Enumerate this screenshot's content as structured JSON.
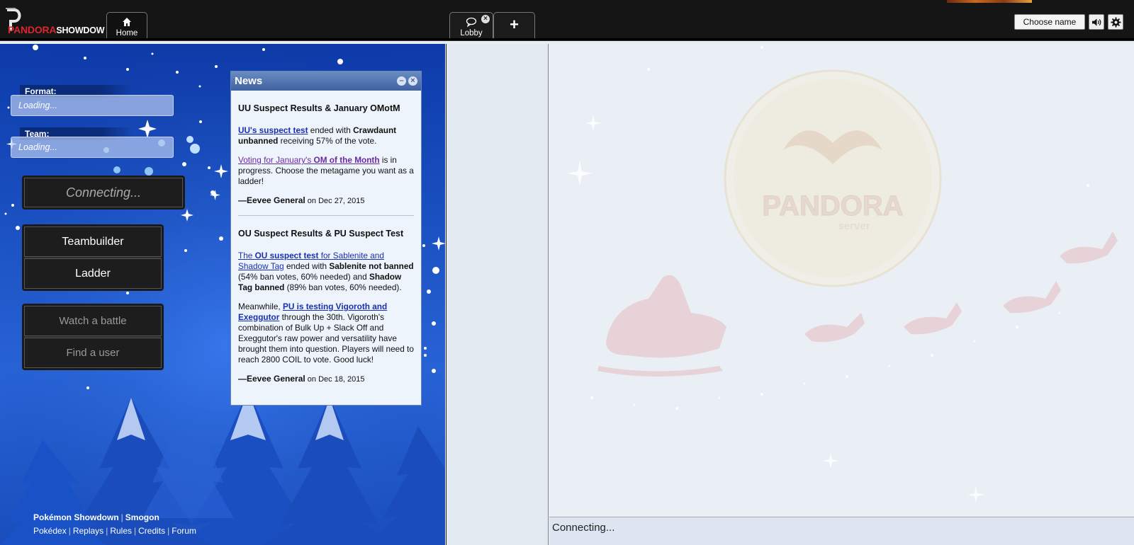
{
  "header": {
    "logo_red": "PANDORA",
    "logo_white": "SHOWDOW",
    "tabs": [
      {
        "label": "Home",
        "icon": "home-icon"
      },
      {
        "label": "Lobby",
        "icon": "chat-bubble-icon"
      },
      {
        "label": "+",
        "icon": "plus-icon"
      }
    ],
    "choose_name": "Choose name",
    "volume_icon": "volume-icon",
    "settings_icon": "gear-icon"
  },
  "home": {
    "format_label": "Format:",
    "format_value": "Loading...",
    "team_label": "Team:",
    "team_value": "Loading...",
    "connect_button": "Connecting...",
    "teambuilder_button": "Teambuilder",
    "ladder_button": "Ladder",
    "watch_button": "Watch a battle",
    "find_user_button": "Find a user",
    "footer": {
      "row1": [
        "Pokémon Showdown",
        "Smogon"
      ],
      "row2": [
        "Pokédex",
        "Replays",
        "Rules",
        "Credits",
        "Forum"
      ]
    }
  },
  "news": {
    "title": "News",
    "items": [
      {
        "title": "UU Suspect Results & January OMotM",
        "p1_link": "UU's suspect test",
        "p1_text1": " ended with ",
        "p1_bold": "Crawdaunt unbanned",
        "p1_text2": " receiving 57% of the vote.",
        "p2_link_a": "Voting for January's ",
        "p2_link_b": "OM of the Month",
        "p2_text": " is in progress. Choose the metagame you want as a ladder!",
        "author": "—Eevee General",
        "date": " on Dec 27, 2015"
      },
      {
        "title": "OU Suspect Results & PU Suspect Test",
        "p1_link_a": "The ",
        "p1_link_b": "OU suspect test",
        "p1_link_c": " for Sablenite and Shadow Tag",
        "p1_text1": " ended with ",
        "p1_bold1": "Sablenite not banned",
        "p1_text2": " (54% ban votes, 60% needed) and ",
        "p1_bold2": "Shadow Tag banned",
        "p1_text3": " (89% ban votes, 60% needed).",
        "p2_text1": "Meanwhile, ",
        "p2_link": "PU is testing Vigoroth and Exeggutor",
        "p2_text2": " through the 30th. Vigoroth's combination of Bulk Up + Slack Off and Exeggutor's raw power and versatility have brought them into question. Players will need to reach 2800 COIL to vote. Good luck!",
        "author": "—Eevee General",
        "date": " on Dec 18, 2015"
      }
    ]
  },
  "chat": {
    "status": "Connecting...",
    "watermark_line1": "PANDORA",
    "watermark_line2": "server"
  }
}
